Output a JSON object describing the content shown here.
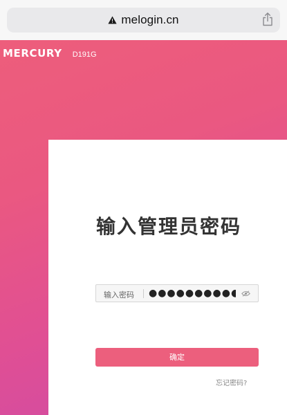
{
  "browser": {
    "url": "melogin.cn",
    "security_icon": "warning-triangle-icon",
    "share_icon": "share-icon"
  },
  "brand": {
    "logo": "MERCURY",
    "model": "D191G"
  },
  "login": {
    "title": "输入管理员密码",
    "password_label": "输入密码",
    "password_value": "●●●●●●●●●●●",
    "visibility_icon": "eye-slash-icon",
    "confirm_label": "确定",
    "forgot_label": "忘记密码?"
  },
  "colors": {
    "accent": "#ec5f7d",
    "background_top": "#ee5f7a",
    "background_bottom": "#cc4aa8"
  }
}
